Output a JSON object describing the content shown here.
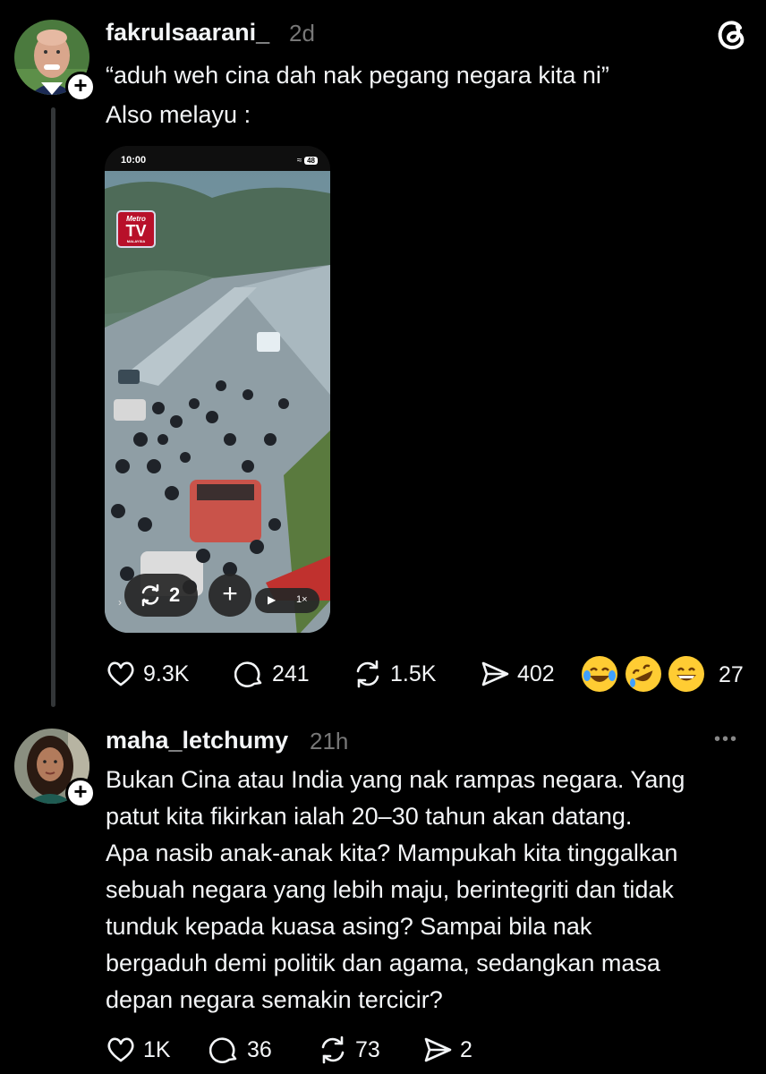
{
  "post": {
    "username": "fakrulsaarani_",
    "time": "2d",
    "line1": "“aduh weh cina dah nak pegang negara kita ni”",
    "line2": "Also melayu :",
    "video": {
      "status_time": "10:00",
      "battery": "48",
      "channel_logo_line1": "Metro",
      "channel_logo_line2": "TV",
      "channel_logo_line3": "MALAYSIA",
      "repost_count": "2",
      "speed": "1×"
    },
    "stats": {
      "likes": "9.3K",
      "replies": "241",
      "reposts": "1.5K",
      "shares": "402",
      "reactions": "27"
    }
  },
  "reply": {
    "username": "maha_letchumy",
    "time": "21h",
    "lines": [
      "Bukan Cina atau India yang nak rampas negara. Yang",
      "patut kita fikirkan ialah 20–30 tahun akan datang.",
      "Apa nasib anak-anak kita? Mampukah kita tinggalkan",
      "sebuah negara yang lebih maju, berintegriti dan tidak",
      "tunduk kepada kuasa asing? Sampai bila nak",
      "bergaduh demi politik dan agama, sedangkan masa",
      "depan negara semakin tercicir?"
    ],
    "stats": {
      "likes": "1K",
      "replies": "36",
      "reposts": "73",
      "shares": "2"
    }
  },
  "colors": {
    "background": "#000000",
    "text": "#f3f5f7",
    "muted": "#777777",
    "line": "#333638"
  }
}
